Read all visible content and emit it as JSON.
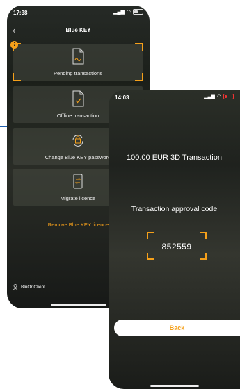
{
  "back_phone": {
    "status": {
      "time": "17:38"
    },
    "header": {
      "title": "Blue KEY"
    },
    "tiles": [
      {
        "label": "Pending transactions",
        "icon": "document-signature-icon",
        "badge": "!"
      },
      {
        "label": "Offline transaction",
        "icon": "document-check-icon"
      },
      {
        "label": "Change Blue KEY password",
        "icon": "lock-refresh-icon"
      },
      {
        "label": "Migrate licence",
        "icon": "phone-transfer-icon"
      }
    ],
    "remove_link": "Remove Blue KEY licence",
    "footer": {
      "client_name": "BluOr Client"
    }
  },
  "front_phone": {
    "status": {
      "time": "14:03"
    },
    "transaction_amount": "100.00 EUR 3D Transaction",
    "approval_label": "Transaction approval code",
    "approval_code": "852559",
    "back_button": "Back"
  },
  "colors": {
    "accent": "#f5a01a",
    "connector": "#1f5fae"
  }
}
